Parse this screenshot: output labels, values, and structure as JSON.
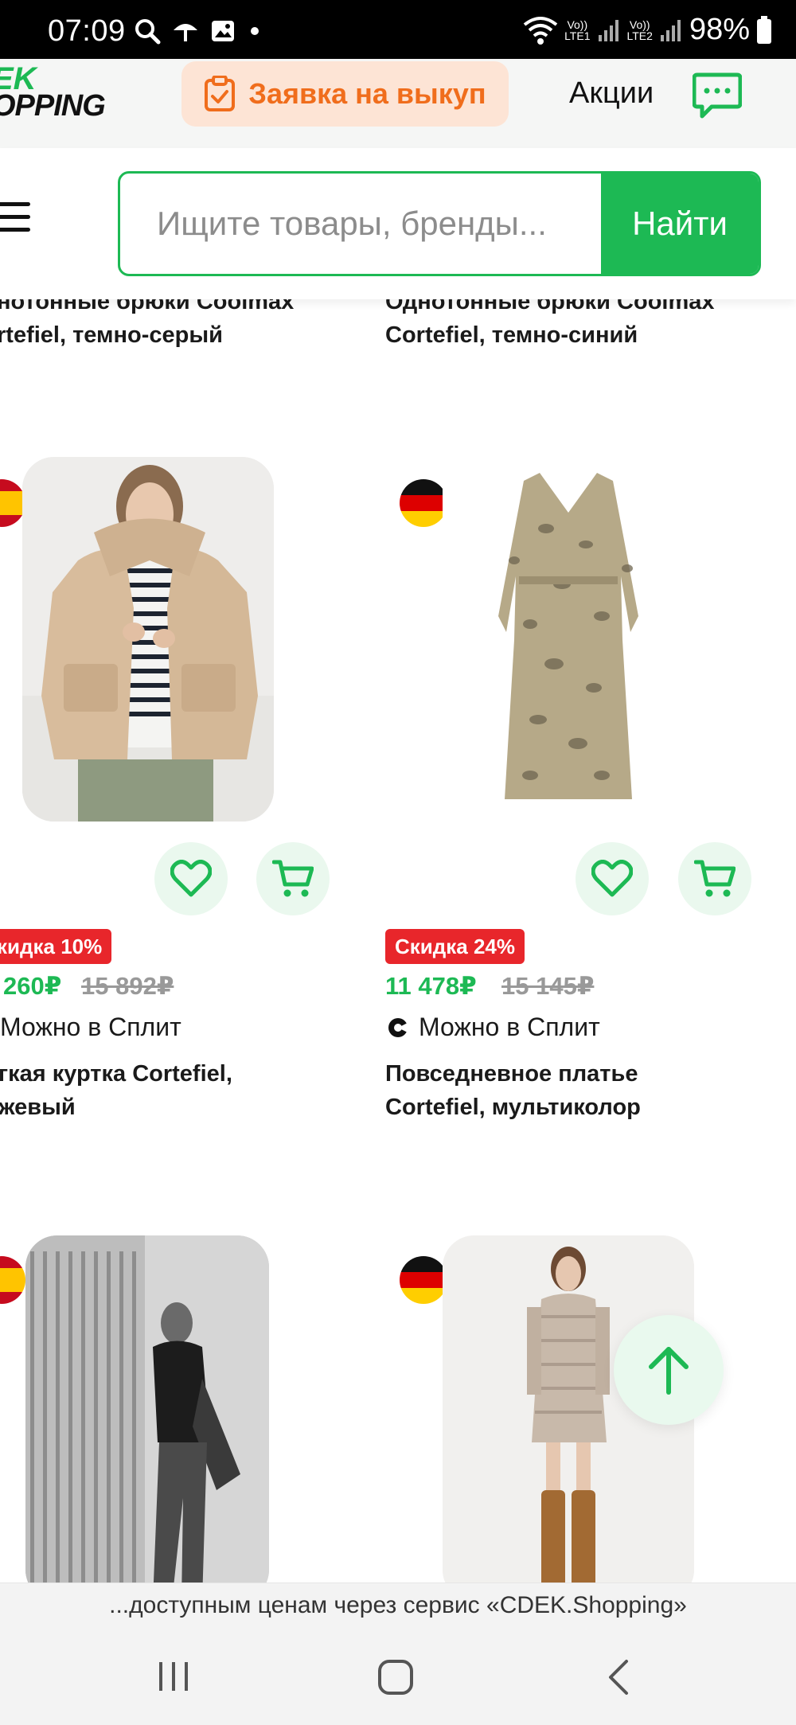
{
  "status_bar": {
    "time": "07:09",
    "net1_top": "Vo))",
    "net1_bottom": "LTE1",
    "net2_top": "Vo))",
    "net2_bottom": "LTE2",
    "battery": "98%"
  },
  "header": {
    "logo_line1": "EK",
    "logo_line2": "OPPING",
    "claim_button": "Заявка на выкуп",
    "promo_link": "Акции"
  },
  "search": {
    "placeholder": "Ищите товары, бренды...",
    "button": "Найти"
  },
  "products_top": [
    {
      "title": "нотонные брюки Coolmax\nrtefiel, темно-серый"
    },
    {
      "title": "Однотонные брюки Coolmax\nCortefiel, темно-синий"
    }
  ],
  "products": [
    {
      "discount": "кидка 10%",
      "price": "260₽",
      "old_price": "15 892₽",
      "split": "Можно в Сплит",
      "name_line1": "гкая куртка Cortefiel,",
      "name_line2": "жевый"
    },
    {
      "discount": "Скидка 24%",
      "price": "11 478₽",
      "old_price": "15 145₽",
      "split": "Можно в Сплит",
      "name_line1": "Повседневное платье",
      "name_line2": "Cortefiel, мультиколор"
    }
  ],
  "bottom_banner": "...доступным ценам через сервис «CDEK.Shopping»",
  "colors": {
    "brand_green": "#1db954",
    "accent_orange": "#f06d1c",
    "discount_red": "#e8262b"
  }
}
